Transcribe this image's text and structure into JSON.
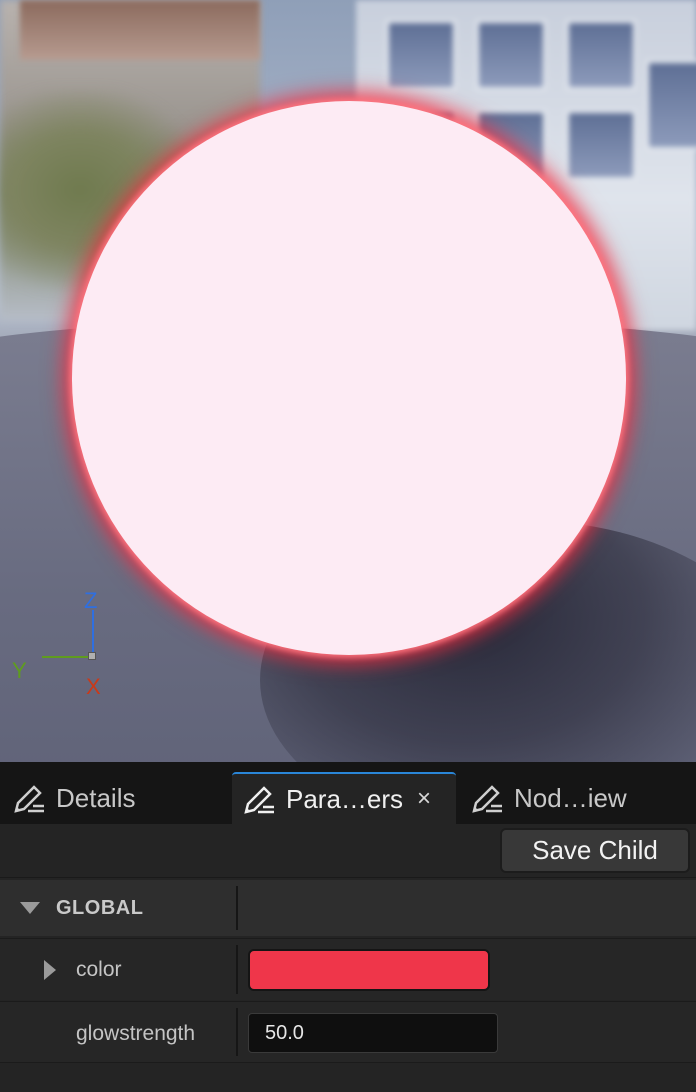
{
  "viewport": {
    "axis": {
      "z": "Z",
      "y": "Y",
      "x": "X"
    },
    "sphere_color": "#fdebf4",
    "glow_color": "#e62a3c"
  },
  "tabs": [
    {
      "label": "Details",
      "icon": "pencil-edit-icon",
      "active": false
    },
    {
      "label": "Para…ers",
      "icon": "pencil-edit-icon",
      "active": true,
      "close": "×"
    },
    {
      "label": "Nod…iew",
      "icon": "pencil-edit-icon",
      "active": false
    }
  ],
  "toolbar": {
    "save_label": "Save Child"
  },
  "parameters": {
    "group_label": "GLOBAL",
    "color": {
      "label": "color",
      "value": "#ef364a"
    },
    "glowstrength": {
      "label": "glowstrength",
      "value": "50.0"
    }
  },
  "colors": {
    "accent": "#2a86d8",
    "panel_bg": "#242424"
  }
}
